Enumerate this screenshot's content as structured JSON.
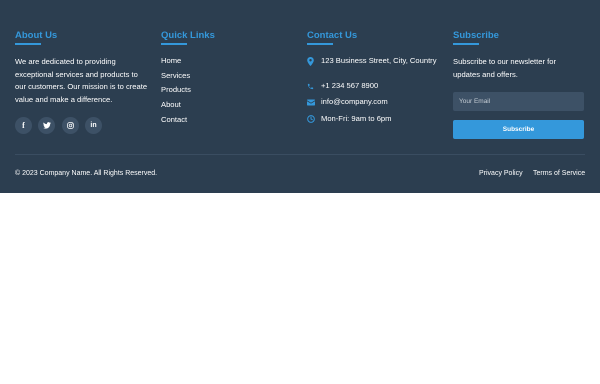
{
  "about": {
    "heading": "About Us",
    "text": "We are dedicated to providing exceptional services and products to our customers. Our mission is to create value and make a difference.",
    "socials": [
      {
        "icon": "facebook-icon",
        "glyph": "f"
      },
      {
        "icon": "twitter-icon",
        "glyph": ""
      },
      {
        "icon": "instagram-icon",
        "glyph": ""
      },
      {
        "icon": "linkedin-icon",
        "glyph": "in"
      }
    ]
  },
  "quick_links": {
    "heading": "Quick Links",
    "items": [
      "Home",
      "Services",
      "Products",
      "About",
      "Contact"
    ]
  },
  "contact": {
    "heading": "Contact Us",
    "address": "123 Business Street, City, Country",
    "phone": "+1 234 567 8900",
    "email": "info@company.com",
    "hours": "Mon-Fri: 9am to 6pm"
  },
  "subscribe": {
    "heading": "Subscribe",
    "text": "Subscribe to our newsletter for updates and offers.",
    "email_placeholder": "Your Email",
    "email_value": "",
    "button_label": "Subscribe"
  },
  "bottom": {
    "copyright": "© 2023 Company Name. All Rights Reserved.",
    "privacy": "Privacy Policy",
    "terms": "Terms of Service"
  },
  "colors": {
    "footer_bg": "#2c3e50",
    "accent": "#3498db",
    "text": "#ffffff",
    "input_bg": "#3d5166",
    "page_bg": "#ffffff"
  }
}
